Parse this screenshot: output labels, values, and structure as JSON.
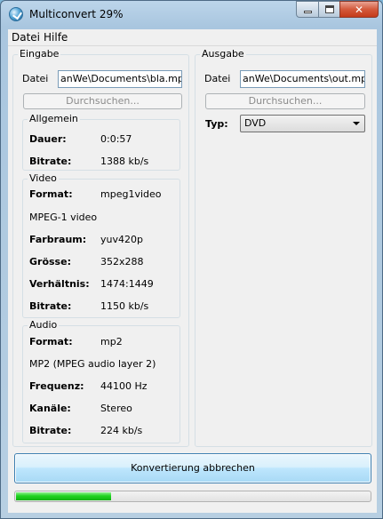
{
  "window": {
    "title": "Multiconvert 29%",
    "close_glyph": "✕"
  },
  "menu": [
    {
      "label": "Datei"
    },
    {
      "label": "Hilfe"
    }
  ],
  "input": {
    "group_label": "Eingabe",
    "file_label": "Datei",
    "file_value": "anWe\\Documents\\bla.mpeg",
    "browse_label": "Durchsuchen...",
    "general": {
      "label": "Allgemein",
      "rows": [
        {
          "key": "Dauer:",
          "value": "0:0:57"
        },
        {
          "key": "Bitrate:",
          "value": "1388 kb/s"
        }
      ]
    },
    "video": {
      "label": "Video",
      "format_key": "Format:",
      "format_value": "mpeg1video",
      "description": "MPEG-1 video",
      "rows": [
        {
          "key": "Farbraum:",
          "value": "yuv420p"
        },
        {
          "key": "Grösse:",
          "value": "352x288"
        },
        {
          "key": "Verhältnis:",
          "value": "1474:1449"
        },
        {
          "key": "Bitrate:",
          "value": "1150 kb/s"
        }
      ]
    },
    "audio": {
      "label": "Audio",
      "format_key": "Format:",
      "format_value": "mp2",
      "description": "MP2 (MPEG audio layer 2)",
      "rows": [
        {
          "key": "Frequenz:",
          "value": "44100 Hz"
        },
        {
          "key": "Kanäle:",
          "value": "Stereo"
        },
        {
          "key": "Bitrate:",
          "value": "224 kb/s"
        }
      ]
    }
  },
  "output": {
    "group_label": "Ausgabe",
    "file_label": "Datei",
    "file_value": "anWe\\Documents\\out.mpeg",
    "browse_label": "Durchsuchen...",
    "type_label": "Typ:",
    "type_value": "DVD"
  },
  "actions": {
    "cancel_label": "Konvertierung abbrechen"
  },
  "progress": {
    "fraction": 0.27
  },
  "colors": {
    "progress_fill": "#1fd31f",
    "close_button": "#c43b1a"
  }
}
